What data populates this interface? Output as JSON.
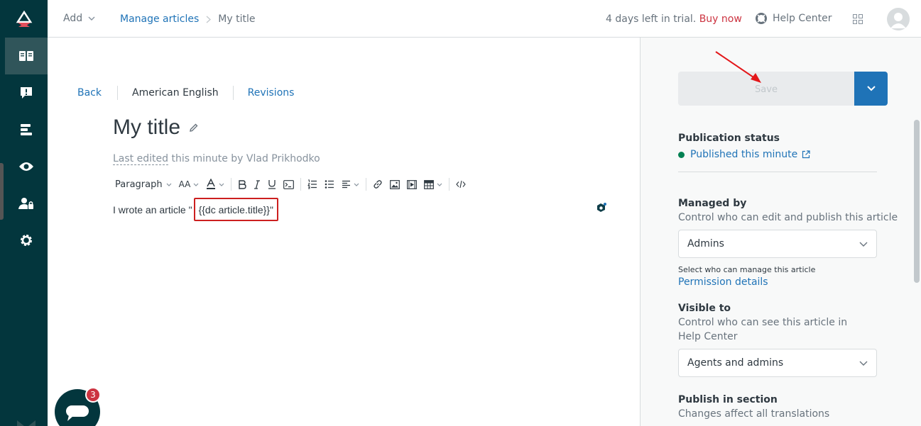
{
  "topbar": {
    "add_label": "Add",
    "breadcrumb": {
      "parent": "Manage articles",
      "current": "My title"
    },
    "trial_text": "4 days left in trial.",
    "buy_label": "Buy now",
    "help_center_label": "Help Center"
  },
  "rail": {
    "items": [
      "logo-icon",
      "guide-book-icon",
      "alert-icon",
      "arrange-icon",
      "eye-icon",
      "user-lock-icon",
      "gear-icon"
    ]
  },
  "editor": {
    "tabs": {
      "back": "Back",
      "language": "American English",
      "revisions": "Revisions"
    },
    "title": "My title",
    "last_edited_prefix": "Last edited",
    "last_edited_suffix": " this minute by Vlad Prikhodko",
    "toolbar": {
      "paragraph": "Paragraph",
      "font_size": "AA"
    },
    "content_prefix": "I wrote an article \"",
    "content_placeholder": "{{dc article.title}}",
    "content_suffix": "\"",
    "chat_badge": "3"
  },
  "panel": {
    "save_label": "Save",
    "publication_status_label": "Publication status",
    "publication_status_value": "Published this minute",
    "managed_by_label": "Managed by",
    "managed_by_hint": "Control who can edit and publish this article",
    "managed_by_value": "Admins",
    "managed_by_small_hint": "Select who can manage this article",
    "permission_link": "Permission details",
    "visible_to_label": "Visible to",
    "visible_to_hint": "Control who can see this article in Help Center",
    "visible_to_value": "Agents and admins",
    "publish_section_label": "Publish in section",
    "publish_section_hint": "Changes affect all translations"
  },
  "colors": {
    "rail": "#03363d",
    "link": "#1f73b7",
    "buy": "#cc3340",
    "highlight_box": "#cc1f1f",
    "status_dot": "#038153"
  }
}
